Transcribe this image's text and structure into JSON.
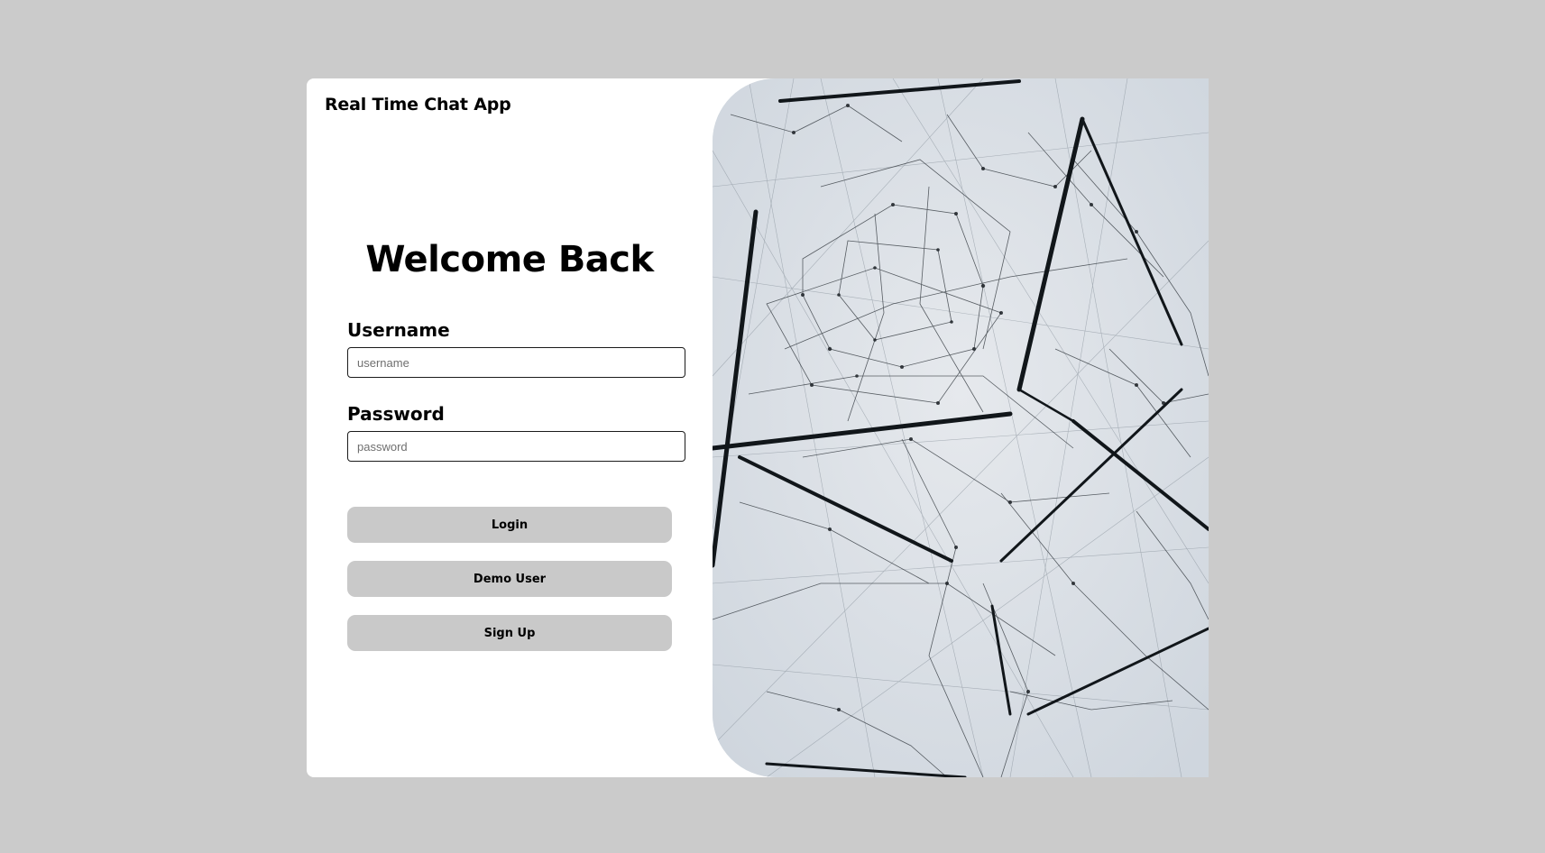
{
  "app": {
    "title": "Real Time Chat App"
  },
  "form": {
    "heading": "Welcome Back",
    "username": {
      "label": "Username",
      "placeholder": "username",
      "value": ""
    },
    "password": {
      "label": "Password",
      "placeholder": "password",
      "value": ""
    }
  },
  "buttons": {
    "login": "Login",
    "demo": "Demo User",
    "signup": "Sign Up"
  },
  "image": {
    "icon": "network-web-photo"
  },
  "colors": {
    "page_background": "#cbcbcb",
    "card_background": "#ffffff",
    "button_background": "#c9c9c9",
    "text": "#000000"
  }
}
